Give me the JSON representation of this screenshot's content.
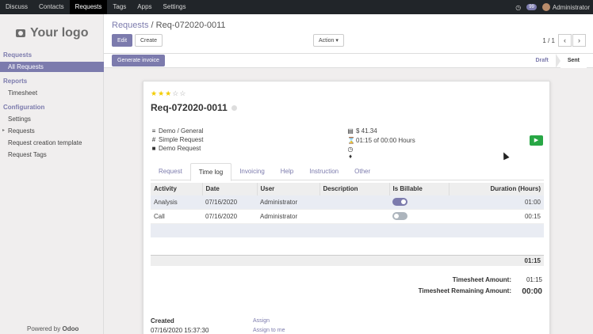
{
  "navbar": {
    "menu": [
      "Discuss",
      "Contacts",
      "Requests",
      "Tags",
      "Apps",
      "Settings"
    ],
    "active_index": 2,
    "chat_badge": "99",
    "user": "Administrator"
  },
  "sidebar": {
    "logo_text": "Your logo",
    "sections": [
      {
        "title": "Requests",
        "items": [
          {
            "label": "All Requests",
            "active": true
          }
        ]
      },
      {
        "title": "Reports",
        "items": [
          {
            "label": "Timesheet"
          }
        ]
      },
      {
        "title": "Configuration",
        "items": [
          {
            "label": "Settings"
          },
          {
            "label": "Requests",
            "collapsible": true
          },
          {
            "label": "Request creation template"
          },
          {
            "label": "Request Tags"
          }
        ]
      }
    ],
    "powered_prefix": "Powered by",
    "powered_brand": "Odoo"
  },
  "control": {
    "breadcrumb_parent": "Requests",
    "breadcrumb_sep": "/",
    "breadcrumb_current": "Req-072020-0011",
    "edit_label": "Edit",
    "create_label": "Create",
    "action_label": "Action",
    "pager": "1 / 1"
  },
  "header": {
    "generate_invoice_label": "Generate invoice",
    "stages": [
      "Draft",
      "Sent"
    ],
    "current_stage": "Sent"
  },
  "record": {
    "priority": {
      "filled": 3,
      "total": 5
    },
    "name": "Req-072020-0011",
    "category": "Demo / General",
    "type": "Simple Request",
    "service": "Demo Request",
    "price": "$ 41.34",
    "time_spent": "01:15 of 00:00 Hours"
  },
  "tabs": [
    "Request",
    "Time log",
    "Invoicing",
    "Help",
    "Instruction",
    "Other"
  ],
  "active_tab": "Time log",
  "timelog": {
    "columns": [
      "Activity",
      "Date",
      "User",
      "Description",
      "Is Billable",
      "Duration (Hours)"
    ],
    "rows": [
      {
        "activity": "Analysis",
        "date": "07/16/2020",
        "user": "Administrator",
        "description": "",
        "billable": true,
        "duration": "01:00"
      },
      {
        "activity": "Call",
        "date": "07/16/2020",
        "user": "Administrator",
        "description": "",
        "billable": false,
        "duration": "00:15"
      }
    ],
    "total": "01:15"
  },
  "summary": {
    "timesheet_amount_label": "Timesheet Amount:",
    "timesheet_amount": "01:15",
    "remaining_label": "Timesheet Remaining Amount:",
    "remaining": "00:00"
  },
  "footer": {
    "created_label": "Created",
    "created_value": "07/16/2020 15:37:30",
    "assign_label": "Assign",
    "assign_to_me_label": "Assign to me"
  },
  "colors": {
    "brand": "#7c7bad",
    "success": "#28a745",
    "navbar": "#212529"
  }
}
